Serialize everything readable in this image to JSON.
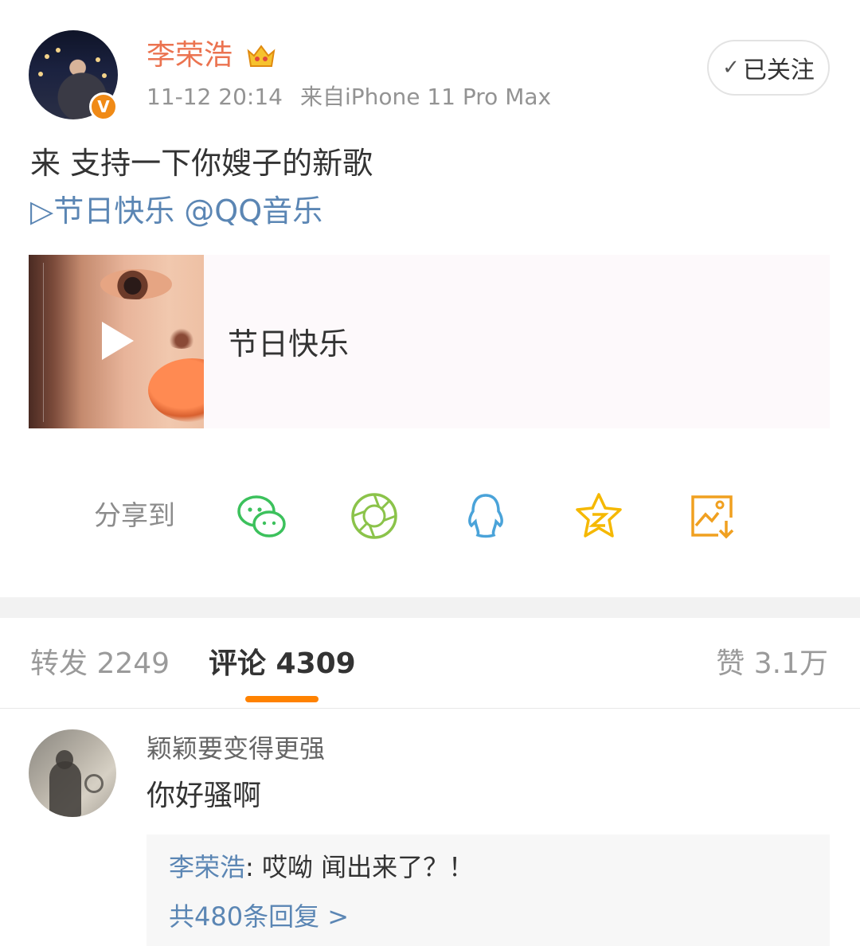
{
  "post": {
    "author": "李荣浩",
    "verified_mark": "V",
    "time": "11-12 20:14",
    "source": "来自iPhone 11 Pro Max",
    "follow_label": "已关注",
    "text": "来 支持一下你嫂子的新歌",
    "link_text": "▷节日快乐 @QQ音乐"
  },
  "music_card": {
    "title": "节日快乐"
  },
  "share": {
    "label": "分享到",
    "targets": [
      "wechat-icon",
      "moments-icon",
      "qq-icon",
      "qzone-icon",
      "save-image-icon"
    ],
    "colors": {
      "wechat": "#3cc15c",
      "moments": "#8bc34a",
      "qq": "#4aa3d9",
      "qzone": "#f5b800",
      "save": "#f0a020"
    }
  },
  "tabs": {
    "repost": "转发 2249",
    "comment": "评论 4309",
    "like": "赞 3.1万"
  },
  "comment": {
    "user": "颖颖要变得更强",
    "text": "你好骚啊",
    "reply_user": "李荣浩",
    "reply_text": ": 哎呦 闻出来了？！",
    "more_replies": "共480条回复 >"
  },
  "colors": {
    "accent": "#ff8200",
    "username": "#eb7350",
    "link": "#5b86b4"
  }
}
